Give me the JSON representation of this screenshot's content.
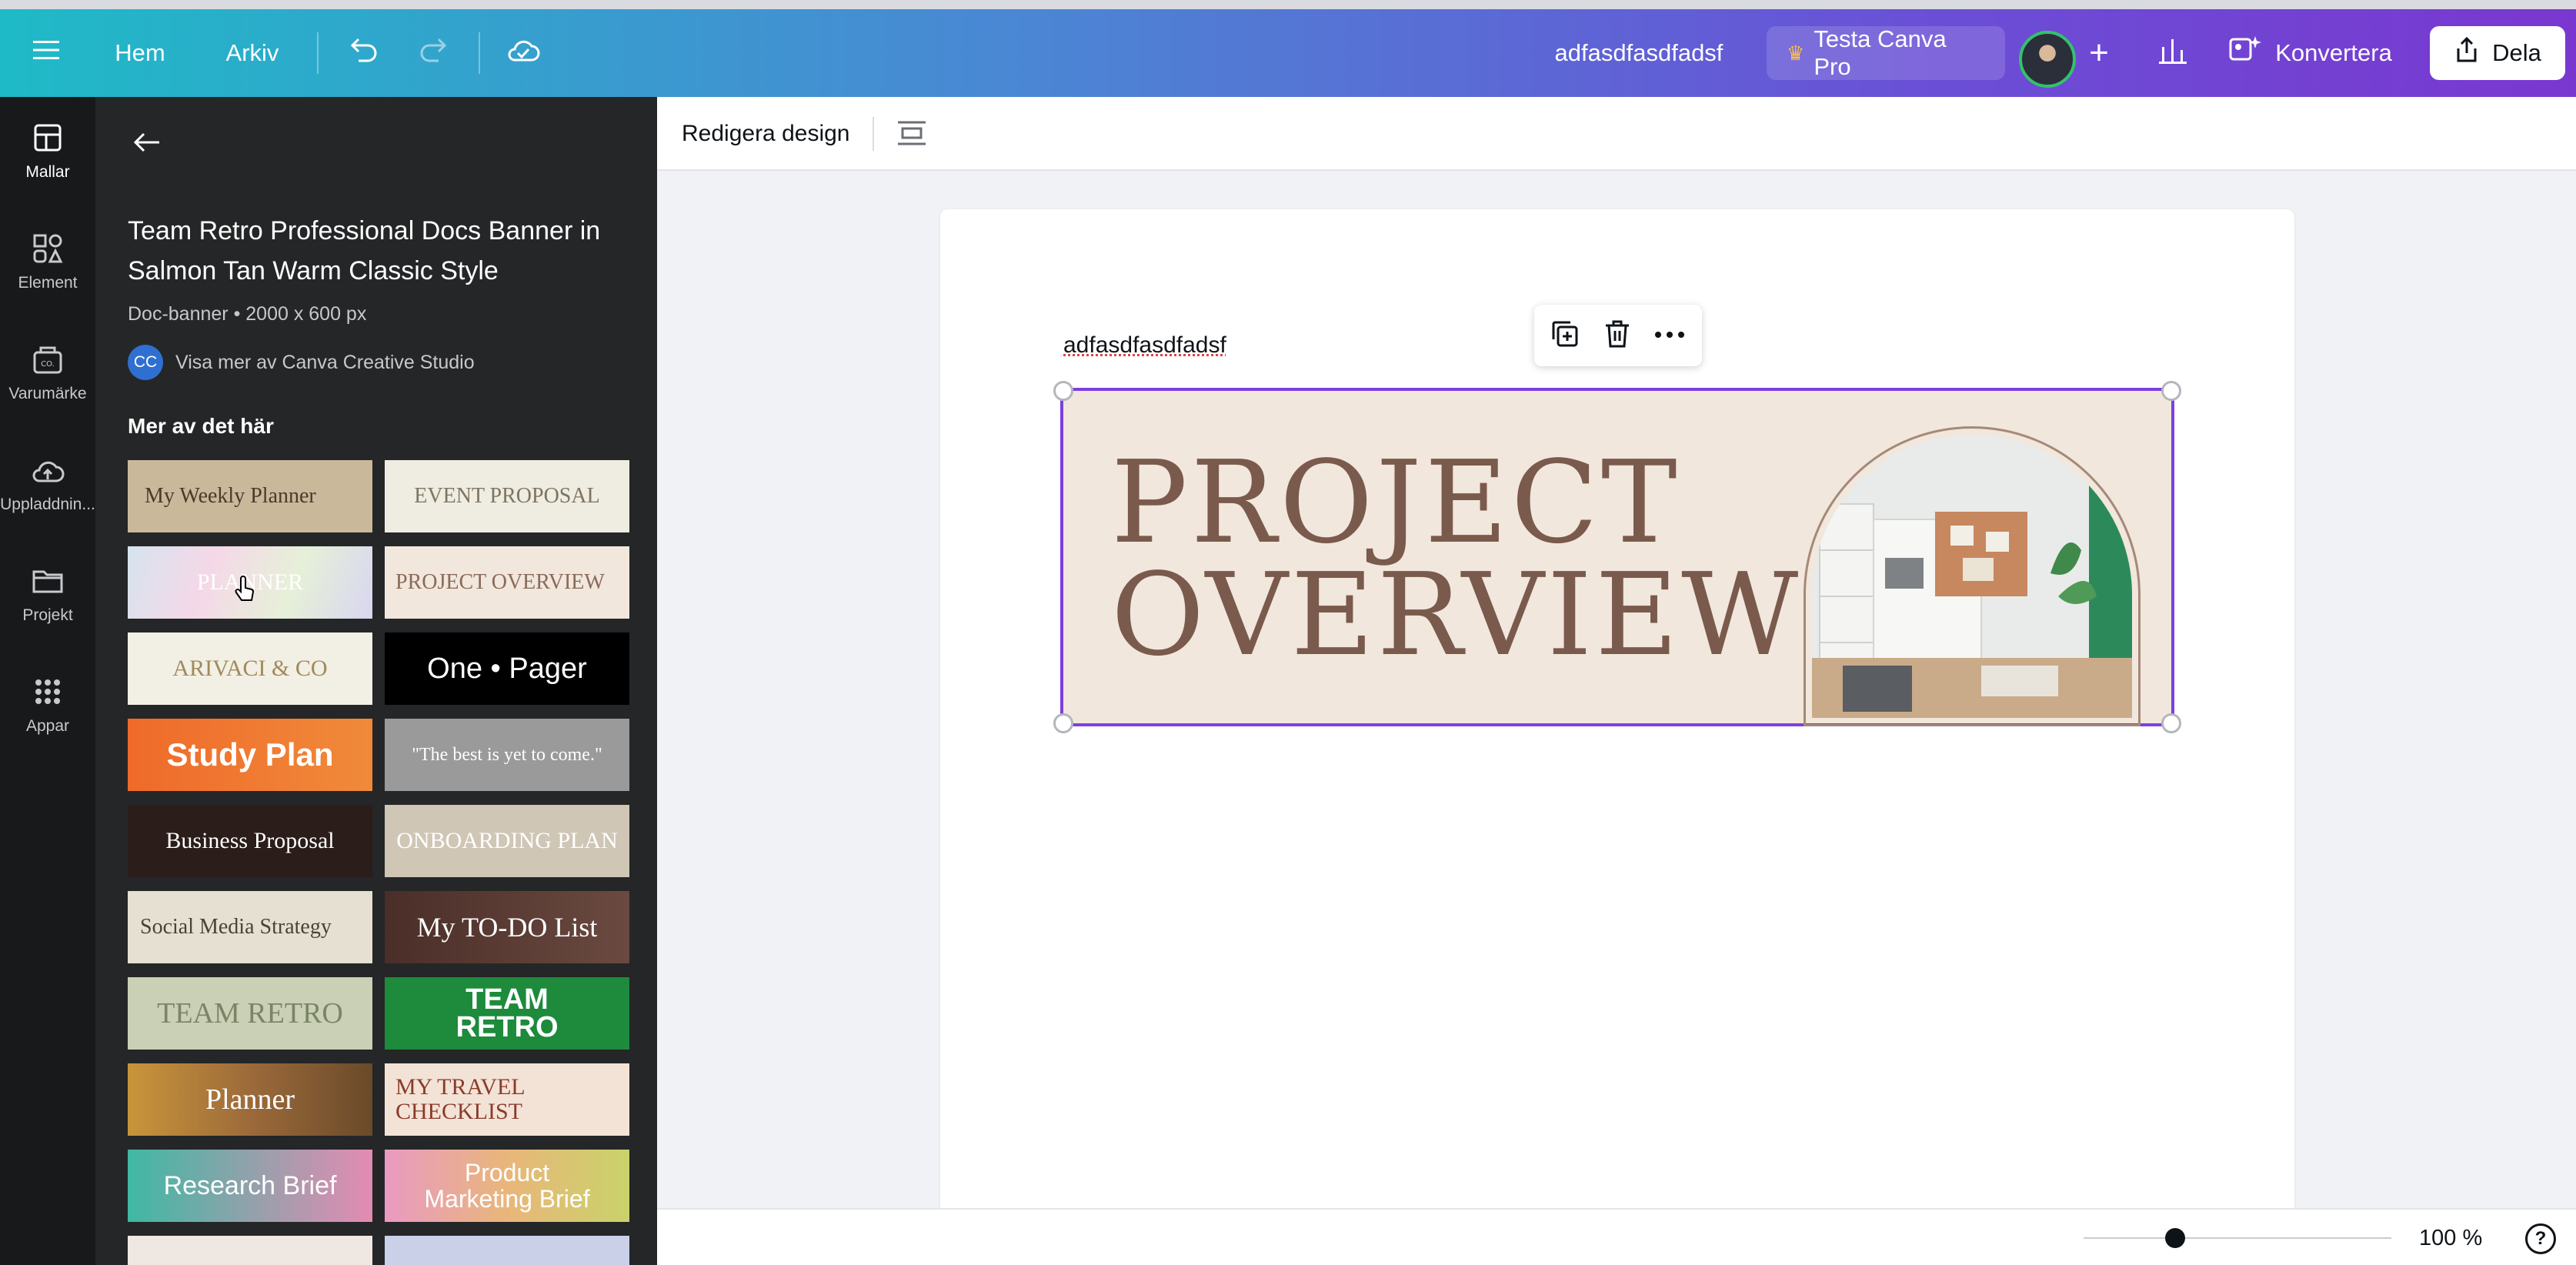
{
  "topbar": {
    "menu_icon": "hamburger-icon",
    "home_label": "Hem",
    "file_label": "Arkiv",
    "doc_name": "adfasdfasdfadsf",
    "pro_label": "Testa Canva Pro",
    "convert_label": "Konvertera",
    "share_label": "Dela",
    "gradient": [
      "#1fbac7",
      "#4b86d4",
      "#7a37d0"
    ]
  },
  "rail": {
    "items": [
      {
        "label": "Mallar",
        "icon": "templates-icon",
        "active": true
      },
      {
        "label": "Element",
        "icon": "elements-icon"
      },
      {
        "label": "Varumärke",
        "icon": "brand-icon"
      },
      {
        "label": "Uppladdnin...",
        "icon": "upload-icon"
      },
      {
        "label": "Projekt",
        "icon": "folder-icon"
      },
      {
        "label": "Appar",
        "icon": "apps-icon"
      }
    ]
  },
  "panel": {
    "title": "Team Retro Professional Docs Banner in Salmon Tan Warm Classic Style",
    "meta": "Doc-banner • 2000 x 600 px",
    "creator_initials": "CC",
    "creator_link": "Visa mer av Canva Creative Studio",
    "more_heading": "Mer av det här",
    "thumbnails": [
      {
        "text": "My Weekly Planner",
        "bg": "#c9b89a",
        "fg": "#4a3a2a"
      },
      {
        "text": "EVENT PROPOSAL",
        "bg": "#efece2",
        "fg": "#7d7562"
      },
      {
        "text": "PLANNER",
        "bg": "#d6e4ee",
        "fg": "#ffffff"
      },
      {
        "text": "PROJECT OVERVIEW",
        "bg": "#f1e7dc",
        "fg": "#8a6a5a"
      },
      {
        "text": "ARIVACI & CO",
        "bg": "#f2efe4",
        "fg": "#a08a5c"
      },
      {
        "text": "One • Pager",
        "bg": "#000000",
        "fg": "#ffffff"
      },
      {
        "text": "Study Plan",
        "bg": "#ef6a2a",
        "fg": "#ffffff"
      },
      {
        "text": "\"The best is yet to come.\"",
        "bg": "#9a9a9a",
        "fg": "#ffffff"
      },
      {
        "text": "Business Proposal",
        "bg": "#2a1d1a",
        "fg": "#ffffff"
      },
      {
        "text": "ONBOARDING PLAN",
        "bg": "#cfc6b6",
        "fg": "#ffffff"
      },
      {
        "text": "Social Media Strategy",
        "bg": "#e6e0d2",
        "fg": "#4a4236"
      },
      {
        "text": "My TO-DO List",
        "bg": "#4a2e28",
        "fg": "#ffffff"
      },
      {
        "text": "TEAM RETRO",
        "bg": "#c9d0b5",
        "fg": "#7b8466"
      },
      {
        "text": "TEAM RETRO",
        "bg": "#1d8a3c",
        "fg": "#ffffff"
      },
      {
        "text": "Planner",
        "bg": "#9c6a3a",
        "fg": "#ffffff"
      },
      {
        "text": "MY TRAVEL CHECKLIST",
        "bg": "#f3e3d6",
        "fg": "#8a3b2c"
      },
      {
        "text": "Research Brief",
        "bg": "#3fb8a4",
        "fg": "#ffffff"
      },
      {
        "text": "Product Marketing Brief",
        "bg": "#e9b67a",
        "fg": "#ffffff"
      }
    ]
  },
  "editor": {
    "edit_design_label": "Redigera design",
    "doc_text": "adfasdfasdfadsf",
    "banner_line1": "PROJECT",
    "banner_line2": "OVERVIEW",
    "selection_color": "#7d3fe0",
    "zoom": "100 %",
    "help": "?"
  }
}
